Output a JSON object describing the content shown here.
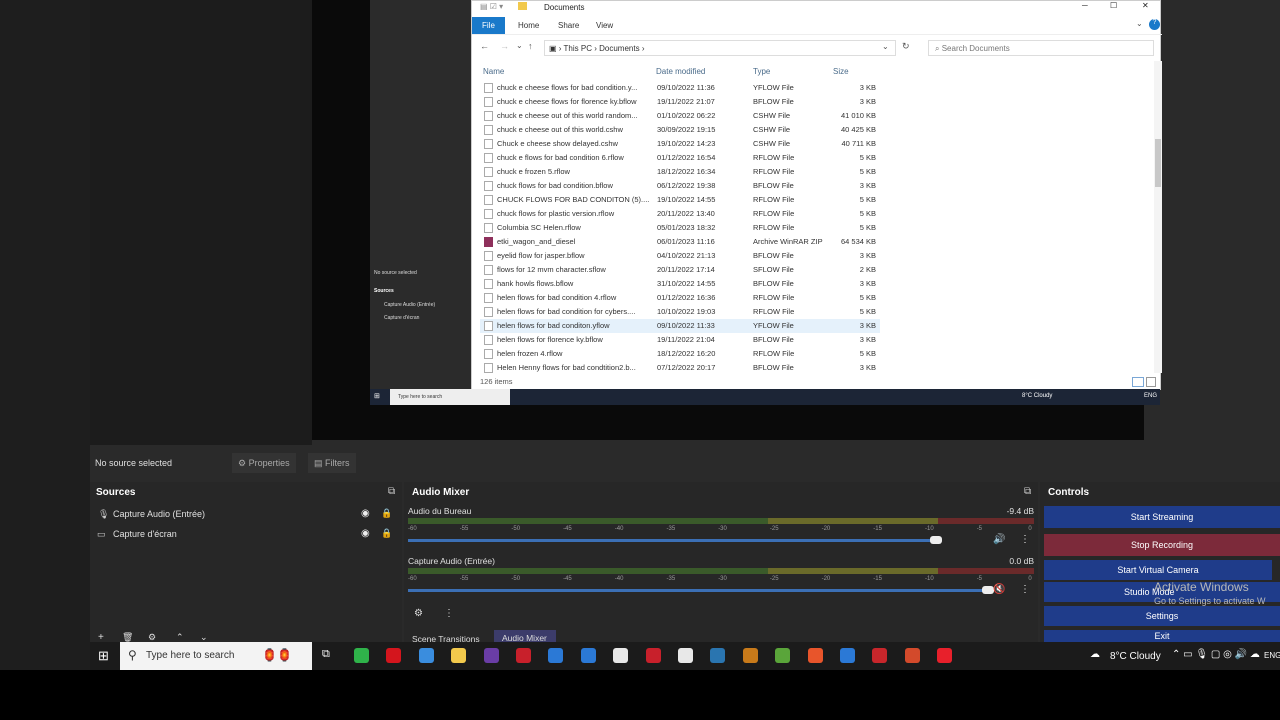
{
  "explorer": {
    "title": "Documents",
    "tabs": [
      "File",
      "Home",
      "Share",
      "View"
    ],
    "breadcrumb": [
      "This PC",
      "Documents"
    ],
    "search_placeholder": "Search Documents",
    "columns": [
      "Name",
      "Date modified",
      "Type",
      "Size"
    ],
    "files": [
      {
        "name": "chuck e cheese flows for bad condition.y...",
        "date": "09/10/2022 11:36",
        "type": "YFLOW File",
        "size": "3 KB"
      },
      {
        "name": "chuck e cheese flows for florence ky.bflow",
        "date": "19/11/2022 21:07",
        "type": "BFLOW File",
        "size": "3 KB"
      },
      {
        "name": "chuck e cheese out of this world random...",
        "date": "01/10/2022 06:22",
        "type": "CSHW File",
        "size": "41 010 KB"
      },
      {
        "name": "chuck e cheese out of this world.cshw",
        "date": "30/09/2022 19:15",
        "type": "CSHW File",
        "size": "40 425 KB"
      },
      {
        "name": "Chuck e cheese show delayed.cshw",
        "date": "19/10/2022 14:23",
        "type": "CSHW File",
        "size": "40 711 KB"
      },
      {
        "name": "chuck e flows for bad condition 6.rflow",
        "date": "01/12/2022 16:54",
        "type": "RFLOW File",
        "size": "5 KB"
      },
      {
        "name": "chuck e frozen 5.rflow",
        "date": "18/12/2022 16:34",
        "type": "RFLOW File",
        "size": "5 KB"
      },
      {
        "name": "chuck flows for bad condition.bflow",
        "date": "06/12/2022 19:38",
        "type": "BFLOW File",
        "size": "3 KB"
      },
      {
        "name": "CHUCK FLOWS FOR BAD CONDITON (5)....",
        "date": "19/10/2022 14:55",
        "type": "RFLOW File",
        "size": "5 KB"
      },
      {
        "name": "chuck flows for plastic version.rflow",
        "date": "20/11/2022 13:40",
        "type": "RFLOW File",
        "size": "5 KB"
      },
      {
        "name": "Columbia SC Helen.rflow",
        "date": "05/01/2023 18:32",
        "type": "RFLOW File",
        "size": "5 KB"
      },
      {
        "name": "etki_wagon_and_diesel",
        "date": "06/01/2023 11:16",
        "type": "Archive WinRAR ZIP",
        "size": "64 534 KB"
      },
      {
        "name": "eyelid flow for jasper.bflow",
        "date": "04/10/2022 21:13",
        "type": "BFLOW File",
        "size": "3 KB"
      },
      {
        "name": "flows for 12 mvm character.sflow",
        "date": "20/11/2022 17:14",
        "type": "SFLOW File",
        "size": "2 KB"
      },
      {
        "name": "hank howls flows.bflow",
        "date": "31/10/2022 14:55",
        "type": "BFLOW File",
        "size": "3 KB"
      },
      {
        "name": "helen flows for bad condition 4.rflow",
        "date": "01/12/2022 16:36",
        "type": "RFLOW File",
        "size": "5 KB"
      },
      {
        "name": "helen flows for bad condition for cybers....",
        "date": "10/10/2022 19:03",
        "type": "RFLOW File",
        "size": "5 KB"
      },
      {
        "name": "helen flows for bad conditon.yflow",
        "date": "09/10/2022 11:33",
        "type": "YFLOW File",
        "size": "3 KB"
      },
      {
        "name": "helen flows for florence ky.bflow",
        "date": "19/11/2022 21:04",
        "type": "BFLOW File",
        "size": "3 KB"
      },
      {
        "name": "helen frozen 4.rflow",
        "date": "18/12/2022 16:20",
        "type": "RFLOW File",
        "size": "5 KB"
      },
      {
        "name": "Helen Henny flows for bad condtition2.b...",
        "date": "07/12/2022 20:17",
        "type": "BFLOW File",
        "size": "3 KB"
      }
    ],
    "item_count": "126 items"
  },
  "nested": {
    "no_source": "No source selected",
    "sources_title": "Sources",
    "sources": [
      "Capture Audio (Entrée)",
      "Capture d'écran"
    ],
    "search": "Type here to search",
    "weather": "8°C Cloudy",
    "lang": "ENG"
  },
  "obs": {
    "no_source": "No source selected",
    "properties": "Properties",
    "filters": "Filters",
    "sources_title": "Sources",
    "sources": [
      "Capture Audio (Entrée)",
      "Capture d'écran"
    ],
    "mixer_title": "Audio Mixer",
    "channels": [
      {
        "name": "Audio du Bureau",
        "db": "-9.4 dB",
        "level": 0.91
      },
      {
        "name": "Capture Audio (Entrée)",
        "db": "0.0 dB",
        "level": 1.0
      }
    ],
    "scale": [
      "-60",
      "-55",
      "-50",
      "-45",
      "-40",
      "-35",
      "-30",
      "-25",
      "-20",
      "-15",
      "-10",
      "-5",
      "0"
    ],
    "dock_tabs": [
      "Scene Transitions",
      "Audio Mixer"
    ],
    "controls_title": "Controls",
    "controls": [
      "Start Streaming",
      "Stop Recording",
      "Start Virtual Camera",
      "Studio Mode",
      "Settings",
      "Exit"
    ],
    "watermark": [
      "Activate Windows",
      "Go to Settings to activate W"
    ]
  },
  "taskbar": {
    "search": "Type here to search",
    "weather": "8°C Cloudy",
    "lang": "ENG"
  },
  "colors": {
    "explorer_select": "#e5f1fb",
    "stop_recording": "#7c2a3a",
    "control_button": "#1f3c8a",
    "slider": "#3b6fb5"
  }
}
